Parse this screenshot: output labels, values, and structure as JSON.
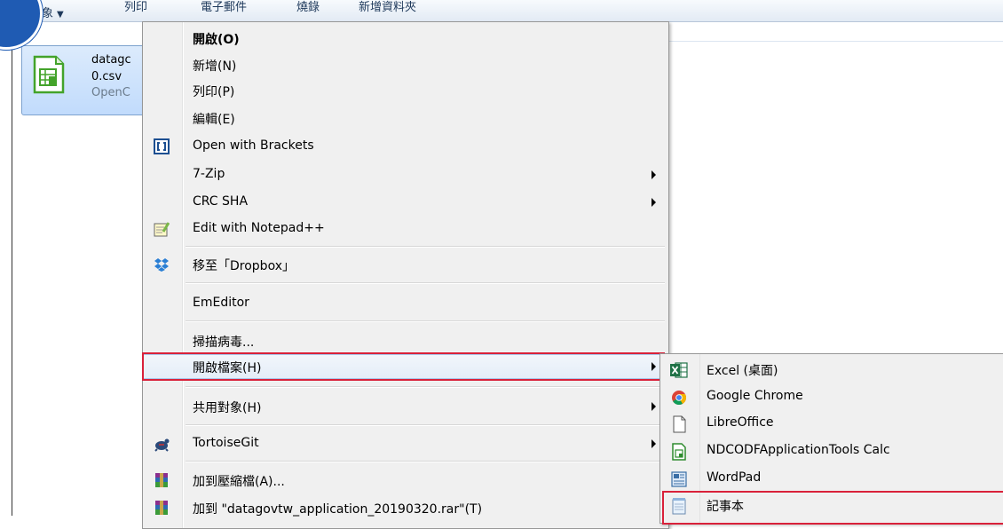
{
  "toolbar": {
    "items": [
      "對象",
      "列印",
      "電子郵件",
      "燒錄",
      "新增資料夾"
    ]
  },
  "file": {
    "name_line1": "datagc",
    "name_line2": "0.csv",
    "type": "OpenC"
  },
  "context_menu": {
    "items": [
      {
        "label": "開啟(O)",
        "bold": true
      },
      {
        "label": "新增(N)"
      },
      {
        "label": "列印(P)"
      },
      {
        "label": "編輯(E)"
      },
      {
        "label": "Open with Brackets",
        "icon": "brackets-icon"
      },
      {
        "label": "7-Zip",
        "submenu": true
      },
      {
        "label": "CRC SHA",
        "submenu": true
      },
      {
        "label": "Edit with Notepad++",
        "icon": "notepad-plus-plus-icon"
      },
      {
        "label": "移至「Dropbox」",
        "icon": "dropbox-icon"
      },
      {
        "label": "EmEditor"
      },
      {
        "label": "掃描病毒..."
      },
      {
        "label": "開啟檔案(H)",
        "submenu": true,
        "highlighted": true
      },
      {
        "label": "共用對象(H)",
        "submenu": true
      },
      {
        "label": "TortoiseGit",
        "submenu": true,
        "icon": "tortoisegit-icon"
      },
      {
        "label": "加到壓縮檔(A)...",
        "icon": "winrar-icon"
      },
      {
        "label": "加到 \"datagovtw_application_20190320.rar\"(T)",
        "icon": "winrar-icon"
      }
    ]
  },
  "open_with_submenu": {
    "items": [
      {
        "label": "Excel (桌面)",
        "icon": "excel-icon"
      },
      {
        "label": "Google Chrome",
        "icon": "chrome-icon"
      },
      {
        "label": "LibreOffice",
        "icon": "blank-document-icon"
      },
      {
        "label": "NDCODFApplicationTools Calc",
        "icon": "spreadsheet-icon"
      },
      {
        "label": "WordPad",
        "icon": "wordpad-icon"
      },
      {
        "label": "記事本",
        "icon": "notepad-icon",
        "highlighted": true
      }
    ]
  },
  "colors": {
    "annotation_red": "#d9213a",
    "badge_blue": "#1f5bb3",
    "menu_bg": "#f0f0f0"
  }
}
